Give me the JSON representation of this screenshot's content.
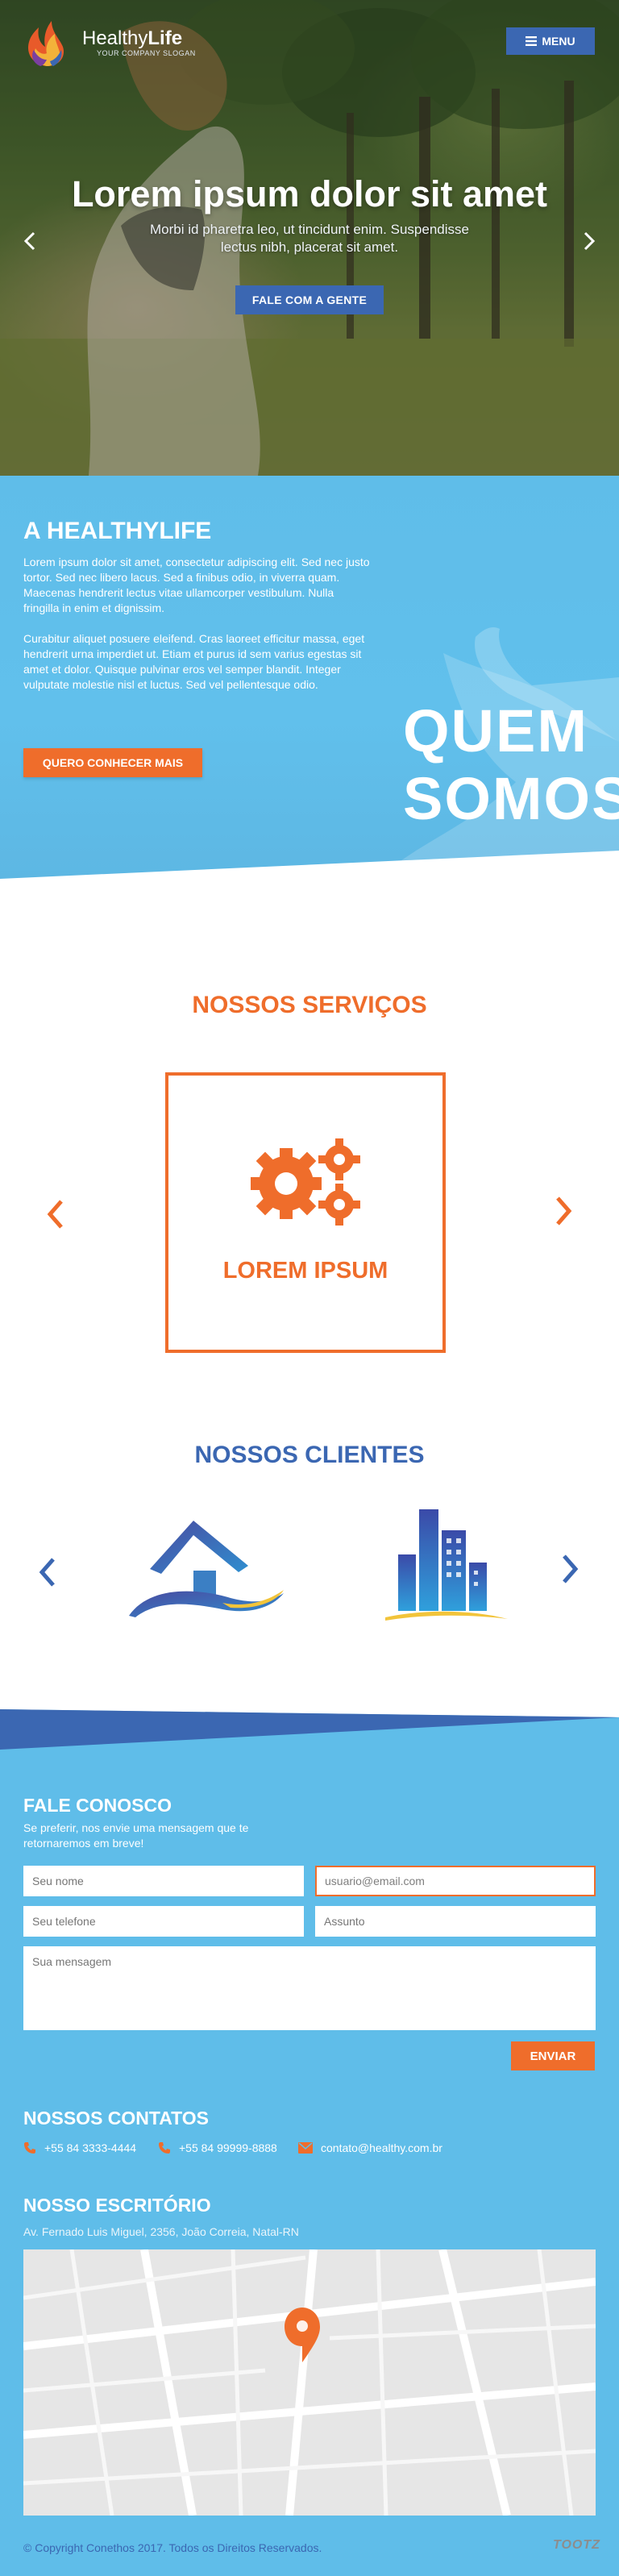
{
  "header": {
    "brand_light": "Healthy",
    "brand_bold": "Life",
    "tagline": "YOUR COMPANY SLOGAN",
    "menu_label": "MENU",
    "menu_icon": "hamburger-icon"
  },
  "hero": {
    "title": "Lorem ipsum dolor sit amet",
    "subtitle": "Morbi id pharetra leo, ut tincidunt enim. Suspendisse lectus nibh, placerat sit amet.",
    "cta_label": "FALE COM A GENTE",
    "prev_icon": "chevron-left-icon",
    "next_icon": "chevron-right-icon"
  },
  "about": {
    "title": "A HEALTHYLIFE",
    "paragraph_1": "Lorem ipsum dolor sit amet, consectetur adipiscing elit. Sed nec justo tortor. Sed nec libero lacus. Sed a finibus odio, in viverra quam. Maecenas hendrerit lectus vitae ullamcorper vestibulum. Nulla fringilla in enim et dignissim.",
    "paragraph_2": "Curabitur aliquet posuere eleifend. Cras laoreet efficitur massa, eget hendrerit urna imperdiet ut. Etiam et purus id sem varius egestas sit amet et dolor. Quisque pulvinar eros vel semper blandit. Integer vulputate molestie nisl et luctus. Sed vel pellentesque odio.",
    "cta_label": "QUERO CONHECER MAIS",
    "big_line_1": "QUEM",
    "big_line_2": "SOMOS"
  },
  "services": {
    "title": "NOSSOS SERVIÇOS",
    "card_label": "LOREM IPSUM",
    "card_icon": "gears-icon"
  },
  "clients": {
    "title": "NOSSOS CLIENTES",
    "logos": [
      "house-logo",
      "buildings-logo"
    ]
  },
  "contact": {
    "title": "FALE CONOSCO",
    "intro": "Se preferir, nos envie uma mensagem que te retornaremos em breve!",
    "name_placeholder": "Seu nome",
    "email_value": "usuario@email.com",
    "phone_placeholder": "Seu telefone",
    "subject_placeholder": "Assunto",
    "message_placeholder": "Sua mensagem",
    "send_label": "ENVIAR"
  },
  "contacts": {
    "title": "NOSSOS CONTATOS",
    "phone_1": "+55 84 3333-4444",
    "phone_2": "+55 84 99999-8888",
    "email": "contato@healthy.com.br"
  },
  "office": {
    "title": "NOSSO ESCRITÓRIO",
    "address": "Av. Fernado Luis Miguel, 2356, João Correia, Natal-RN"
  },
  "footer": {
    "copyright": "© Copyright Conethos 2017. Todos os Direitos Reservados.",
    "credit": "TOOTZ"
  },
  "colors": {
    "blue": "#3b67b2",
    "light_blue": "#5fbde9",
    "orange": "#ef6d2b"
  }
}
